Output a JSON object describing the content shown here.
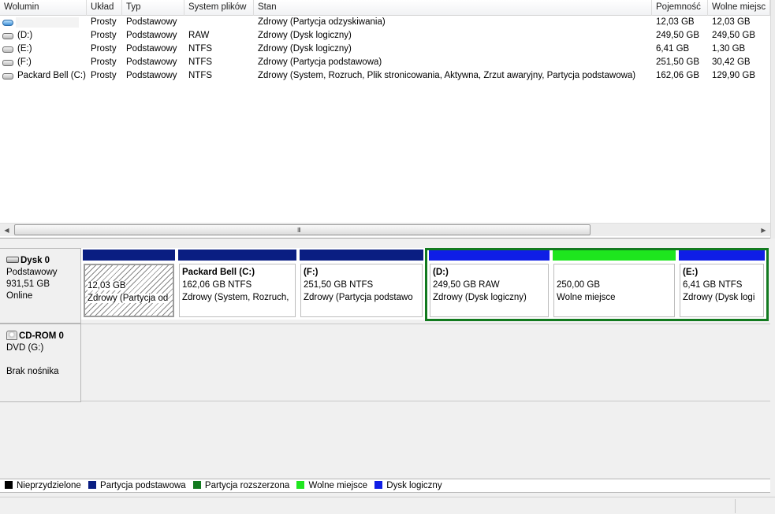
{
  "columns": [
    "Wolumin",
    "Układ",
    "Typ",
    "System plików",
    "Stan",
    "Pojemność",
    "Wolne miejsc"
  ],
  "volumes": [
    {
      "name": "",
      "layout": "Prosty",
      "type": "Podstawowy",
      "fs": "",
      "status": "Zdrowy (Partycja odzyskiwania)",
      "capacity": "12,03 GB",
      "free": "12,03 GB",
      "icon": "recovery-volume-icon"
    },
    {
      "name": "(D:)",
      "layout": "Prosty",
      "type": "Podstawowy",
      "fs": "RAW",
      "status": "Zdrowy (Dysk logiczny)",
      "capacity": "249,50 GB",
      "free": "249,50 GB",
      "icon": "drive-icon"
    },
    {
      "name": "(E:)",
      "layout": "Prosty",
      "type": "Podstawowy",
      "fs": "NTFS",
      "status": "Zdrowy (Dysk logiczny)",
      "capacity": "6,41 GB",
      "free": "1,30 GB",
      "icon": "drive-icon"
    },
    {
      "name": "(F:)",
      "layout": "Prosty",
      "type": "Podstawowy",
      "fs": "NTFS",
      "status": "Zdrowy (Partycja podstawowa)",
      "capacity": "251,50 GB",
      "free": "30,42 GB",
      "icon": "drive-icon"
    },
    {
      "name": "Packard Bell (C:)",
      "layout": "Prosty",
      "type": "Podstawowy",
      "fs": "NTFS",
      "status": "Zdrowy (System, Rozruch, Plik stronicowania, Aktywna, Zrzut awaryjny, Partycja podstawowa)",
      "capacity": "162,06 GB",
      "free": "129,90 GB",
      "icon": "drive-icon"
    }
  ],
  "hscroll_grip": "III",
  "disks": [
    {
      "title": "Dysk 0",
      "type": "Podstawowy",
      "size": "931,51 GB",
      "state": "Online"
    },
    {
      "title": "CD-ROM 0",
      "type": "DVD (G:)",
      "size": "",
      "state": "Brak nośnika"
    }
  ],
  "partitions": [
    {
      "name": "",
      "size": "12,03 GB",
      "status": "Zdrowy (Partycja od",
      "bar_color": "#0a1e82"
    },
    {
      "name": "Packard Bell  (C:)",
      "size": "162,06 GB NTFS",
      "status": "Zdrowy (System, Rozruch,",
      "bar_color": "#0a1e82"
    },
    {
      "name": "(F:)",
      "size": "251,50 GB NTFS",
      "status": "Zdrowy (Partycja podstawo",
      "bar_color": "#0a1e82"
    },
    {
      "name": "(D:)",
      "size": "249,50 GB RAW",
      "status": "Zdrowy (Dysk logiczny)",
      "bar_color": "#0f1ee6"
    },
    {
      "name": "",
      "size": "250,00 GB",
      "status": "Wolne miejsce",
      "bar_color": "#1ee61e"
    },
    {
      "name": "(E:)",
      "size": "6,41 GB NTFS",
      "status": "Zdrowy (Dysk logi",
      "bar_color": "#0f1ee6"
    }
  ],
  "legend": [
    {
      "label": "Nieprzydzielone",
      "color": "#000000"
    },
    {
      "label": "Partycja podstawowa",
      "color": "#0a1e82"
    },
    {
      "label": "Partycja rozszerzona",
      "color": "#127a1f"
    },
    {
      "label": "Wolne miejsce",
      "color": "#1ee61e"
    },
    {
      "label": "Dysk logiczny",
      "color": "#0f1ee6"
    }
  ]
}
